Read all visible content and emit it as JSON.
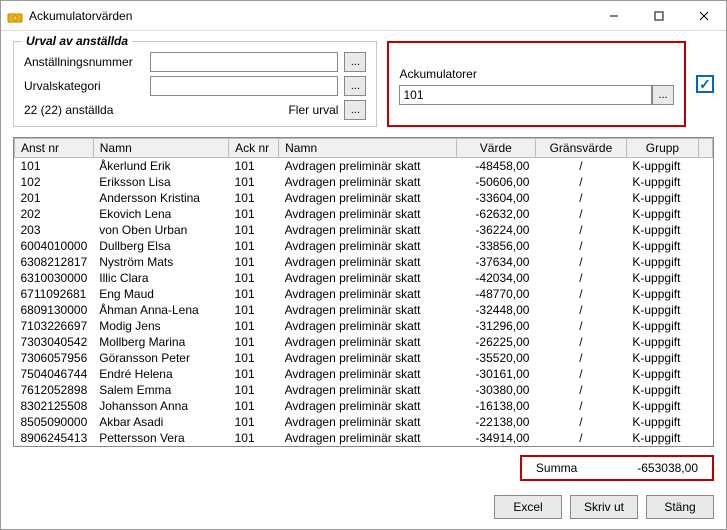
{
  "window": {
    "title": "Ackumulatorvärden"
  },
  "selection_panel": {
    "legend": "Urval av anställda",
    "row1_label": "Anställningsnummer",
    "row1_value": "",
    "row2_label": "Urvalskategori",
    "row2_value": "",
    "status_text": "22 (22) anställda",
    "more_label": "Fler urval"
  },
  "accum_panel": {
    "label": "Ackumulatorer",
    "value": "101"
  },
  "table": {
    "headers": {
      "anst": "Anst nr",
      "namn": "Namn",
      "acknr": "Ack nr",
      "ackname": "Namn",
      "varde": "Värde",
      "grans": "Gränsvärde",
      "grupp": "Grupp"
    },
    "rows": [
      {
        "anst": "101",
        "namn": "Åkerlund Erik",
        "acknr": "101",
        "ackname": "Avdragen preliminär skatt",
        "varde": "-48458,00",
        "grans": "/",
        "grupp": "K-uppgift"
      },
      {
        "anst": "102",
        "namn": "Eriksson Lisa",
        "acknr": "101",
        "ackname": "Avdragen preliminär skatt",
        "varde": "-50606,00",
        "grans": "/",
        "grupp": "K-uppgift"
      },
      {
        "anst": "201",
        "namn": "Andersson Kristina",
        "acknr": "101",
        "ackname": "Avdragen preliminär skatt",
        "varde": "-33604,00",
        "grans": "/",
        "grupp": "K-uppgift"
      },
      {
        "anst": "202",
        "namn": "Ekovich Lena",
        "acknr": "101",
        "ackname": "Avdragen preliminär skatt",
        "varde": "-62632,00",
        "grans": "/",
        "grupp": "K-uppgift"
      },
      {
        "anst": "203",
        "namn": "von Oben Urban",
        "acknr": "101",
        "ackname": "Avdragen preliminär skatt",
        "varde": "-36224,00",
        "grans": "/",
        "grupp": "K-uppgift"
      },
      {
        "anst": "6004010000",
        "namn": "Dullberg Elsa",
        "acknr": "101",
        "ackname": "Avdragen preliminär skatt",
        "varde": "-33856,00",
        "grans": "/",
        "grupp": "K-uppgift"
      },
      {
        "anst": "6308212817",
        "namn": "Nyström Mats",
        "acknr": "101",
        "ackname": "Avdragen preliminär skatt",
        "varde": "-37634,00",
        "grans": "/",
        "grupp": "K-uppgift"
      },
      {
        "anst": "6310030000",
        "namn": "Illic Clara",
        "acknr": "101",
        "ackname": "Avdragen preliminär skatt",
        "varde": "-42034,00",
        "grans": "/",
        "grupp": "K-uppgift"
      },
      {
        "anst": "6711092681",
        "namn": "Eng Maud",
        "acknr": "101",
        "ackname": "Avdragen preliminär skatt",
        "varde": "-48770,00",
        "grans": "/",
        "grupp": "K-uppgift"
      },
      {
        "anst": "6809130000",
        "namn": "Åhman Anna-Lena",
        "acknr": "101",
        "ackname": "Avdragen preliminär skatt",
        "varde": "-32448,00",
        "grans": "/",
        "grupp": "K-uppgift"
      },
      {
        "anst": "7103226697",
        "namn": "Modig Jens",
        "acknr": "101",
        "ackname": "Avdragen preliminär skatt",
        "varde": "-31296,00",
        "grans": "/",
        "grupp": "K-uppgift"
      },
      {
        "anst": "7303040542",
        "namn": "Mollberg Marina",
        "acknr": "101",
        "ackname": "Avdragen preliminär skatt",
        "varde": "-26225,00",
        "grans": "/",
        "grupp": "K-uppgift"
      },
      {
        "anst": "7306057956",
        "namn": "Göransson Peter",
        "acknr": "101",
        "ackname": "Avdragen preliminär skatt",
        "varde": "-35520,00",
        "grans": "/",
        "grupp": "K-uppgift"
      },
      {
        "anst": "7504046744",
        "namn": "Endré Helena",
        "acknr": "101",
        "ackname": "Avdragen preliminär skatt",
        "varde": "-30161,00",
        "grans": "/",
        "grupp": "K-uppgift"
      },
      {
        "anst": "7612052898",
        "namn": "Salem Emma",
        "acknr": "101",
        "ackname": "Avdragen preliminär skatt",
        "varde": "-30380,00",
        "grans": "/",
        "grupp": "K-uppgift"
      },
      {
        "anst": "8302125508",
        "namn": "Johansson Anna",
        "acknr": "101",
        "ackname": "Avdragen preliminär skatt",
        "varde": "-16138,00",
        "grans": "/",
        "grupp": "K-uppgift"
      },
      {
        "anst": "8505090000",
        "namn": "Akbar Asadi",
        "acknr": "101",
        "ackname": "Avdragen preliminär skatt",
        "varde": "-22138,00",
        "grans": "/",
        "grupp": "K-uppgift"
      },
      {
        "anst": "8906245413",
        "namn": "Pettersson Vera",
        "acknr": "101",
        "ackname": "Avdragen preliminär skatt",
        "varde": "-34914,00",
        "grans": "/",
        "grupp": "K-uppgift"
      }
    ]
  },
  "summary": {
    "label": "Summa",
    "value": "-653038,00"
  },
  "footer": {
    "excel": "Excel",
    "print": "Skriv ut",
    "close": "Stäng"
  }
}
